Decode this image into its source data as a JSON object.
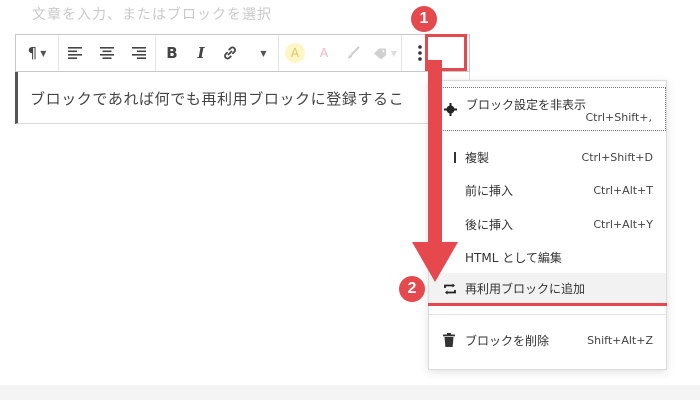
{
  "editor": {
    "placeholder": "文章を入力、またはブロックを選択",
    "content_text": "ブロックであれば何でも再利用ブロックに登録するこ"
  },
  "toolbar": {
    "paragraph_icon": "pilcrow-icon",
    "bold_label": "B",
    "italic_label": "I",
    "highlight_label": "A",
    "text_color_label": "A",
    "more_icon": "vertical-ellipsis-icon"
  },
  "menu": {
    "items": [
      {
        "label": "ブロック設定を非表示",
        "shortcut": "Ctrl+Shift+,",
        "icon": "gear-icon"
      },
      {
        "label": "複製",
        "shortcut": "Ctrl+Shift+D",
        "icon": "duplicate-icon"
      },
      {
        "label": "前に挿入",
        "shortcut": "Ctrl+Alt+T",
        "icon": ""
      },
      {
        "label": "後に挿入",
        "shortcut": "Ctrl+Alt+Y",
        "icon": ""
      },
      {
        "label": "HTML として編集",
        "shortcut": "",
        "icon": ""
      },
      {
        "label": "再利用ブロックに追加",
        "shortcut": "",
        "icon": "reusable-icon"
      },
      {
        "label": "ブロックを削除",
        "shortcut": "Shift+Alt+Z",
        "icon": "trash-icon"
      }
    ]
  },
  "annotations": {
    "badge_1": "1",
    "badge_2": "2",
    "accent_color": "#e5484d"
  }
}
